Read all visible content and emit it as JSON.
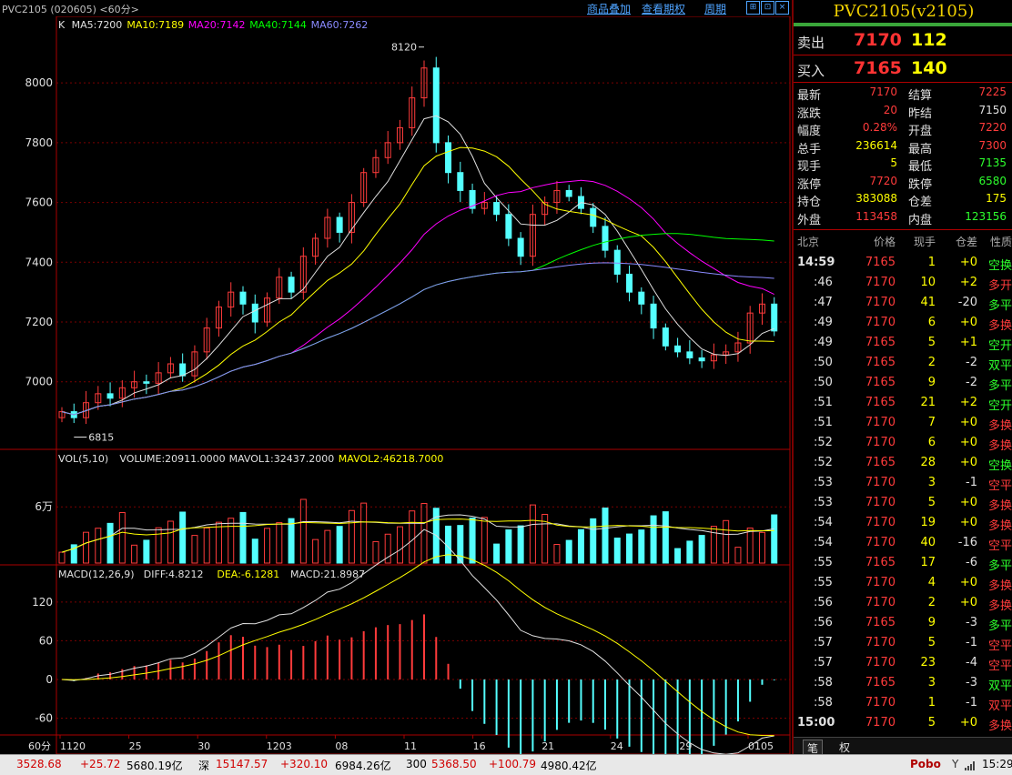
{
  "window": {
    "title": "PVC2105 (020605) <60分>",
    "links": [
      "商品叠加",
      "查看期权",
      "周期"
    ],
    "icons": [
      "grid-icon",
      "zoom-icon",
      "close-icon"
    ]
  },
  "chart_data": [
    {
      "type": "candlestick",
      "panel": "price",
      "legend": [
        {
          "text": "K",
          "color": "#e0e0e0"
        },
        {
          "text": "MA5:7200",
          "color": "#e0e0e0"
        },
        {
          "text": "MA10:7189",
          "color": "#ffff00"
        },
        {
          "text": "MA20:7142",
          "color": "#ff00ff"
        },
        {
          "text": "MA40:7144",
          "color": "#00ff00"
        },
        {
          "text": "MA60:7262",
          "color": "#8a8aff"
        }
      ],
      "y_ticks": [
        "8000",
        "7800",
        "7600",
        "7400",
        "7200",
        "7000"
      ],
      "ylim": [
        6780,
        8180
      ],
      "annotations": [
        {
          "text": "8120",
          "value": 8120
        },
        {
          "text": "6815",
          "value": 6815
        }
      ],
      "x_ticks": [
        "1120",
        "25",
        "30",
        "1203",
        "08",
        "11",
        "16",
        "21",
        "24",
        "29",
        "0105"
      ],
      "close_path": [
        6900,
        6880,
        6930,
        6960,
        6945,
        6980,
        7000,
        6995,
        7030,
        7060,
        7020,
        7100,
        7180,
        7250,
        7300,
        7260,
        7200,
        7280,
        7350,
        7300,
        7420,
        7480,
        7550,
        7500,
        7600,
        7700,
        7750,
        7800,
        7850,
        7950,
        8050,
        7800,
        7700,
        7640,
        7580,
        7600,
        7560,
        7480,
        7420,
        7560,
        7600,
        7640,
        7620,
        7580,
        7520,
        7440,
        7360,
        7300,
        7260,
        7180,
        7120,
        7100,
        7080,
        7070,
        7090,
        7100,
        7130,
        7230,
        7260,
        7170
      ]
    },
    {
      "type": "bar",
      "panel": "volume",
      "legend": [
        {
          "text": "VOL(5,10)",
          "color": "#e0e0e0"
        },
        {
          "text": "VOLUME:20911.0000",
          "color": "#e0e0e0"
        },
        {
          "text": "MAVOL1:32437.2000",
          "color": "#e0e0e0"
        },
        {
          "text": "MAVOL2:46218.7000",
          "color": "#ffff00"
        }
      ],
      "y_ticks": [
        "6万"
      ],
      "ylim": [
        0,
        100000
      ]
    },
    {
      "type": "bar",
      "panel": "macd",
      "legend": [
        {
          "text": "MACD(12,26,9)",
          "color": "#e0e0e0"
        },
        {
          "text": "DIFF:4.8212",
          "color": "#e0e0e0"
        },
        {
          "text": "DEA:-6.1281",
          "color": "#ffff00"
        },
        {
          "text": "MACD:21.8987",
          "color": "#e0e0e0"
        }
      ],
      "y_ticks": [
        "120",
        "60",
        "0",
        "-60"
      ],
      "ylim": [
        -110,
        155
      ]
    }
  ],
  "period_label": "60分",
  "quote": {
    "symbol": "PVC2105(v2105)",
    "sell": {
      "label": "卖出",
      "price": "7170",
      "vol": "112"
    },
    "buy": {
      "label": "买入",
      "price": "7165",
      "vol": "140"
    },
    "rows": [
      {
        "l1": "最新",
        "v1": "7170",
        "c1": "red",
        "l2": "结算",
        "v2": "7225",
        "c2": "red"
      },
      {
        "l1": "涨跌",
        "v1": "20",
        "c1": "red",
        "l2": "昨结",
        "v2": "7150",
        "c2": "white"
      },
      {
        "l1": "幅度",
        "v1": "0.28%",
        "c1": "red",
        "l2": "开盘",
        "v2": "7220",
        "c2": "red"
      },
      {
        "l1": "总手",
        "v1": "236614",
        "c1": "yellow",
        "l2": "最高",
        "v2": "7300",
        "c2": "red"
      },
      {
        "l1": "现手",
        "v1": "5",
        "c1": "yellow",
        "l2": "最低",
        "v2": "7135",
        "c2": "green"
      },
      {
        "l1": "涨停",
        "v1": "7720",
        "c1": "red",
        "l2": "跌停",
        "v2": "6580",
        "c2": "green"
      },
      {
        "l1": "持仓",
        "v1": "383088",
        "c1": "yellow",
        "l2": "仓差",
        "v2": "175",
        "c2": "yellow"
      },
      {
        "l1": "外盘",
        "v1": "113458",
        "c1": "red",
        "l2": "内盘",
        "v2": "123156",
        "c2": "green"
      }
    ],
    "tick_header": [
      "北京",
      "价格",
      "现手",
      "仓差",
      "性质"
    ],
    "ticks": [
      {
        "t": "14:59",
        "p": "7165",
        "v": "1",
        "d": "+0",
        "n": "空换",
        "dc": "yellow",
        "nc": "green"
      },
      {
        "t": ":46",
        "p": "7170",
        "v": "10",
        "d": "+2",
        "n": "多开",
        "dc": "yellow",
        "nc": "red"
      },
      {
        "t": ":47",
        "p": "7170",
        "v": "41",
        "d": "-20",
        "n": "多平",
        "dc": "white",
        "nc": "green"
      },
      {
        "t": ":49",
        "p": "7170",
        "v": "6",
        "d": "+0",
        "n": "多换",
        "dc": "yellow",
        "nc": "red"
      },
      {
        "t": ":49",
        "p": "7165",
        "v": "5",
        "d": "+1",
        "n": "空开",
        "dc": "yellow",
        "nc": "green"
      },
      {
        "t": ":50",
        "p": "7165",
        "v": "2",
        "d": "-2",
        "n": "双平",
        "dc": "white",
        "nc": "green"
      },
      {
        "t": ":50",
        "p": "7165",
        "v": "9",
        "d": "-2",
        "n": "多平",
        "dc": "white",
        "nc": "green"
      },
      {
        "t": ":51",
        "p": "7165",
        "v": "21",
        "d": "+2",
        "n": "空开",
        "dc": "yellow",
        "nc": "green"
      },
      {
        "t": ":51",
        "p": "7170",
        "v": "7",
        "d": "+0",
        "n": "多换",
        "dc": "yellow",
        "nc": "red"
      },
      {
        "t": ":52",
        "p": "7170",
        "v": "6",
        "d": "+0",
        "n": "多换",
        "dc": "yellow",
        "nc": "red"
      },
      {
        "t": ":52",
        "p": "7165",
        "v": "28",
        "d": "+0",
        "n": "空换",
        "dc": "yellow",
        "nc": "green"
      },
      {
        "t": ":53",
        "p": "7170",
        "v": "3",
        "d": "-1",
        "n": "空平",
        "dc": "white",
        "nc": "red"
      },
      {
        "t": ":53",
        "p": "7170",
        "v": "5",
        "d": "+0",
        "n": "多换",
        "dc": "yellow",
        "nc": "red"
      },
      {
        "t": ":54",
        "p": "7170",
        "v": "19",
        "d": "+0",
        "n": "多换",
        "dc": "yellow",
        "nc": "red"
      },
      {
        "t": ":54",
        "p": "7170",
        "v": "40",
        "d": "-16",
        "n": "空平",
        "dc": "white",
        "nc": "red"
      },
      {
        "t": ":55",
        "p": "7165",
        "v": "17",
        "d": "-6",
        "n": "多平",
        "dc": "white",
        "nc": "green"
      },
      {
        "t": ":55",
        "p": "7170",
        "v": "4",
        "d": "+0",
        "n": "多换",
        "dc": "yellow",
        "nc": "red"
      },
      {
        "t": ":56",
        "p": "7170",
        "v": "2",
        "d": "+0",
        "n": "多换",
        "dc": "yellow",
        "nc": "red"
      },
      {
        "t": ":56",
        "p": "7165",
        "v": "9",
        "d": "-3",
        "n": "多平",
        "dc": "white",
        "nc": "green"
      },
      {
        "t": ":57",
        "p": "7170",
        "v": "5",
        "d": "-1",
        "n": "空平",
        "dc": "white",
        "nc": "red"
      },
      {
        "t": ":57",
        "p": "7170",
        "v": "23",
        "d": "-4",
        "n": "空平",
        "dc": "white",
        "nc": "red"
      },
      {
        "t": ":58",
        "p": "7165",
        "v": "3",
        "d": "-3",
        "n": "双平",
        "dc": "white",
        "nc": "green"
      },
      {
        "t": ":58",
        "p": "7170",
        "v": "1",
        "d": "-1",
        "n": "双平",
        "dc": "white",
        "nc": "red"
      },
      {
        "t": "15:00",
        "p": "7170",
        "v": "5",
        "d": "+0",
        "n": "多换",
        "dc": "yellow",
        "nc": "red"
      }
    ],
    "tabs": [
      "笔",
      "权"
    ]
  },
  "status": {
    "sh": {
      "idx": "3528.68",
      "chg": "+25.72",
      "amt": "5680.19亿"
    },
    "sz": {
      "label": "深",
      "idx": "15147.57",
      "chg": "+320.10",
      "amt": "6984.26亿"
    },
    "c300": {
      "label": "300",
      "idx": "5368.50",
      "chg": "+100.79",
      "amt": "4980.42亿"
    },
    "brand": "Pobo",
    "time": "15:29"
  }
}
